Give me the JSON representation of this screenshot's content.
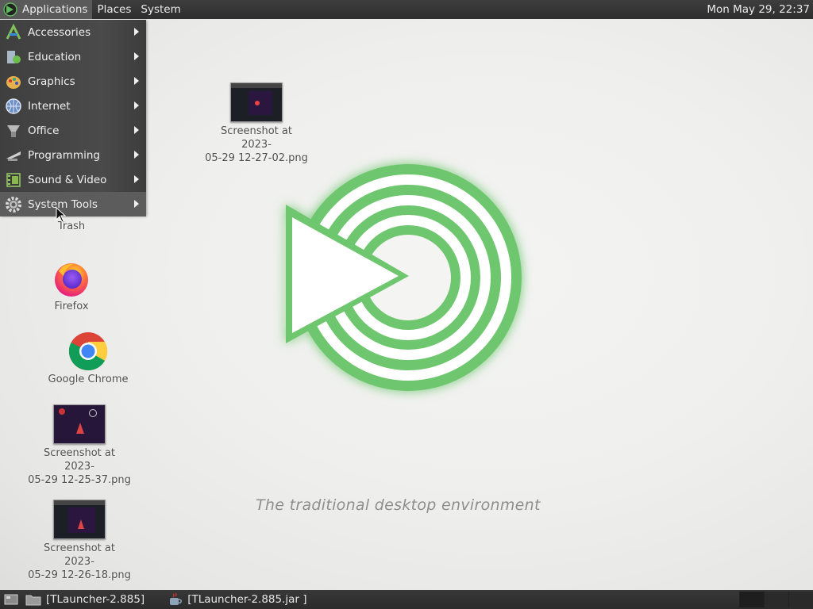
{
  "top_panel": {
    "menus": [
      "Applications",
      "Places",
      "System"
    ],
    "clock": "Mon May 29, 22:37"
  },
  "applications_menu": {
    "items": [
      {
        "label": "Accessories",
        "icon": "accessories-icon"
      },
      {
        "label": "Education",
        "icon": "education-icon"
      },
      {
        "label": "Graphics",
        "icon": "graphics-icon"
      },
      {
        "label": "Internet",
        "icon": "internet-globe-icon"
      },
      {
        "label": "Office",
        "icon": "office-icon"
      },
      {
        "label": "Programming",
        "icon": "programming-icon"
      },
      {
        "label": "Sound & Video",
        "icon": "sound-video-icon"
      },
      {
        "label": "System Tools",
        "icon": "system-tools-gear-icon"
      }
    ],
    "highlighted": "System Tools"
  },
  "desktop": {
    "icons": [
      {
        "label": "Screenshot at 2023-\n05-29 12-27-02.png",
        "icon": "image-thumbnail"
      },
      {
        "label": "Trash",
        "icon": "trash-icon"
      },
      {
        "label": "Firefox",
        "icon": "firefox-icon"
      },
      {
        "label": "Google Chrome",
        "icon": "chrome-icon"
      },
      {
        "label": "Screenshot at 2023-\n05-29 12-25-37.png",
        "icon": "image-thumbnail"
      },
      {
        "label": "Screenshot at 2023-\n05-29 12-26-18.png",
        "icon": "image-thumbnail"
      }
    ],
    "tagline": "The traditional desktop environment"
  },
  "bottom_panel": {
    "tasks": [
      {
        "label": "[TLauncher-2.885]",
        "icon": "folder-icon"
      },
      {
        "label": "[TLauncher-2.885.jar ]",
        "icon": "java-icon"
      }
    ]
  },
  "colors": {
    "panel": "#2e2e2e",
    "menu_bg": "#444444",
    "menu_highlight": "#5c5c5c",
    "logo_green": "#5dbb5d"
  }
}
